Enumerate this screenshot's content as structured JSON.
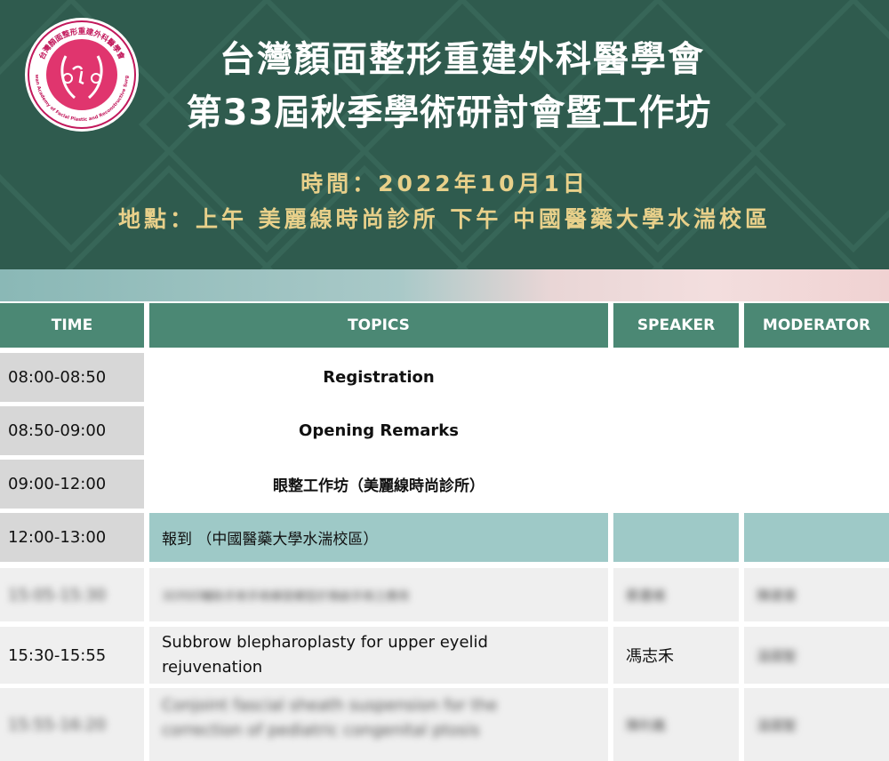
{
  "banner": {
    "logo": {
      "text_top": "台灣顏面整形重建外科醫學會",
      "text_bottom": "Taiwan Academy of Facial Plastic and Reconstructive Surgery"
    },
    "title_line1": "台灣顏面整形重建外科醫學會",
    "title_line2": "第33屆秋季學術研討會暨工作坊",
    "time_line": "時間：2022年10月1日",
    "place_line": "地點：上午 美麗線時尚診所 下午 中國醫藥大學水湍校區"
  },
  "table": {
    "headers": [
      "TIME",
      "TOPICS",
      "SPEAKER",
      "MODERATOR"
    ],
    "rows": [
      {
        "time": "08:00-08:50",
        "topic": "Registration",
        "speaker": "",
        "moderator": ""
      },
      {
        "time": "08:50-09:00",
        "topic": "Opening Remarks",
        "speaker": "",
        "moderator": ""
      },
      {
        "time": "09:00-12:00",
        "topic": "眼整工作坊（美麗線時尚診所）",
        "speaker": "",
        "moderator": ""
      },
      {
        "time": "12:00-13:00",
        "topic": "報到 （中國醫藥大學水湍校區）",
        "speaker": "",
        "moderator": ""
      },
      {
        "time": "15:05-15:30",
        "topic": "3D列印輔助手術手術練習模型於微創手術之應用",
        "speaker": "蔡畫維",
        "moderator": "陳建章"
      },
      {
        "time": "15:30-15:55",
        "topic_line1": "Subbrow blepharoplasty for upper eyelid",
        "topic_line2": "rejuvenation",
        "speaker": "馮志禾",
        "moderator": "溫國聖"
      },
      {
        "time": "15:55-16:20",
        "topic_line1": "Conjoint fascial sheath suspension for the",
        "topic_line2": "correction of pediatric congenital ptosis",
        "speaker": "陳利義",
        "moderator": "溫國聖"
      }
    ]
  }
}
